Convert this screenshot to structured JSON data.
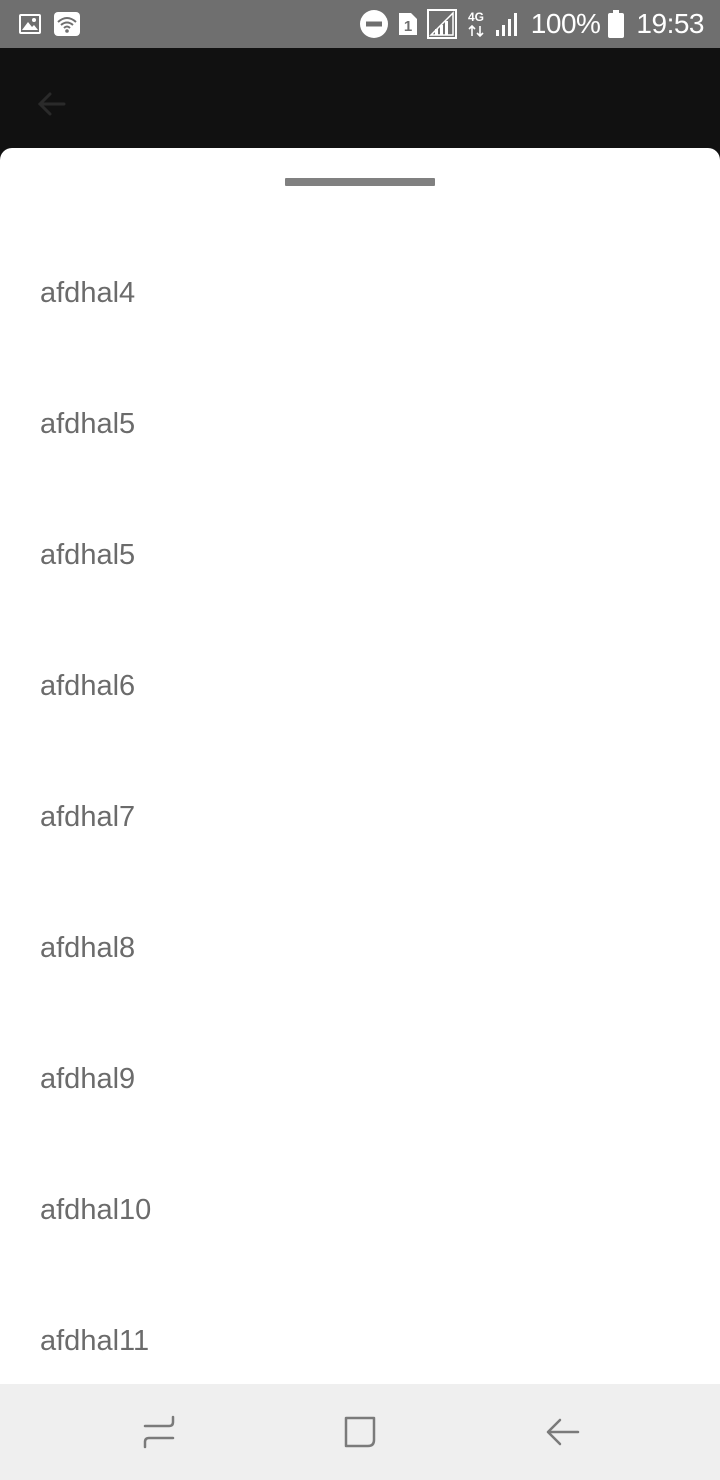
{
  "status_bar": {
    "icons_left": [
      "gallery-icon",
      "wifi-icon"
    ],
    "icons_right": [
      "do-not-disturb-icon",
      "sim-1-icon",
      "signal-icon",
      "4g-icon",
      "signal-bars-icon"
    ],
    "network_label": "4G",
    "sim_label": "1",
    "battery": "100%",
    "time": "19:53"
  },
  "app_bar": {
    "back_icon": "arrow-left-icon"
  },
  "sheet": {
    "items": [
      {
        "label": "afdhal4"
      },
      {
        "label": "afdhal5"
      },
      {
        "label": "afdhal5"
      },
      {
        "label": "afdhal6"
      },
      {
        "label": "afdhal7"
      },
      {
        "label": "afdhal8"
      },
      {
        "label": "afdhal9"
      },
      {
        "label": "afdhal10"
      },
      {
        "label": "afdhal11"
      }
    ]
  },
  "nav_bar": {
    "buttons": [
      "recent-apps-icon",
      "home-icon",
      "back-icon"
    ]
  },
  "colors": {
    "status_bar_bg": "#6f6f6f",
    "app_bar_bg": "#111111",
    "sheet_bg": "#ffffff",
    "item_text": "#6b6b6b",
    "handle": "#808080",
    "nav_bar_bg": "#efefef"
  }
}
